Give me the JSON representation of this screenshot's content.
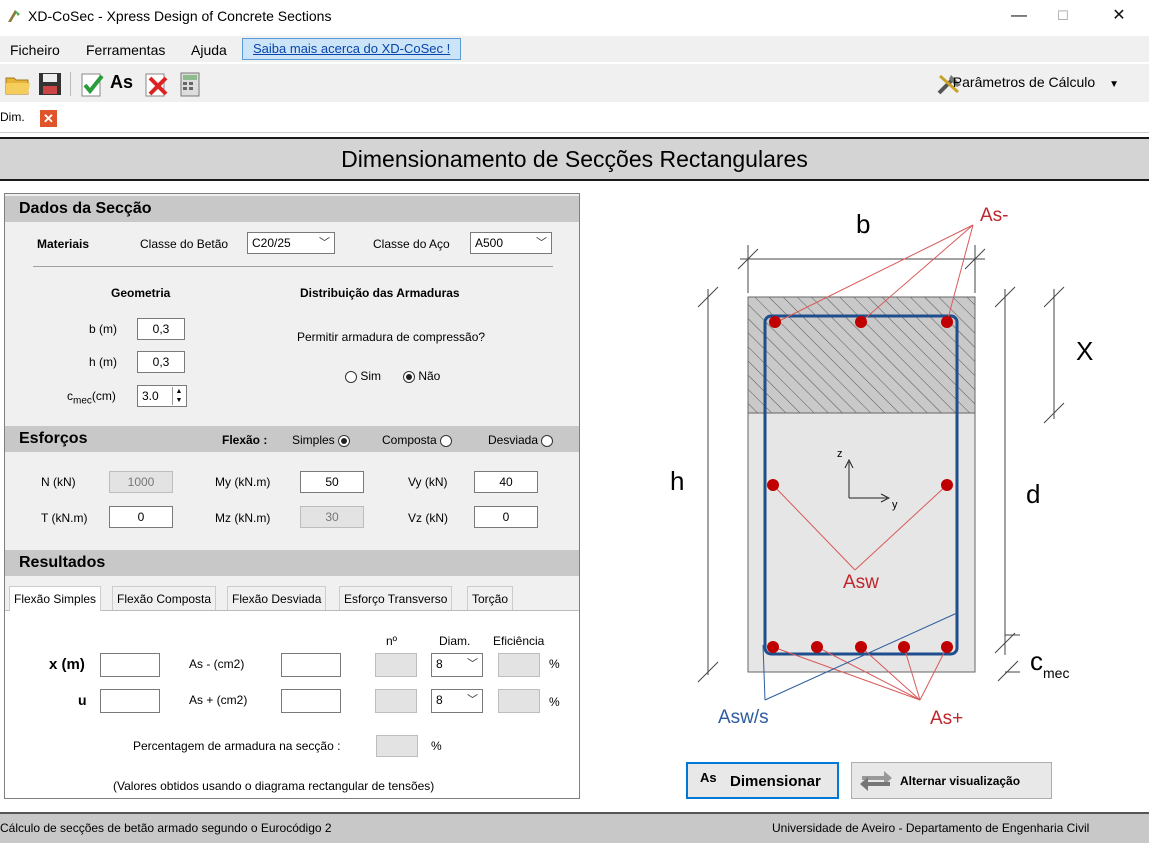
{
  "window": {
    "title": "XD-CoSec  -  Xpress Design of Concrete Sections",
    "minimize": "—",
    "maximize": "☐",
    "close": "✕"
  },
  "menu": {
    "ficheiro": "Ficheiro",
    "ferramentas": "Ferramentas",
    "ajuda": "Ajuda",
    "promo": "Saiba mais acerca do XD-CoSec !"
  },
  "toolbar": {
    "params_label": "Parâmetros de Cálculo",
    "as_label": "As"
  },
  "doc_tab": {
    "label": "Dim."
  },
  "page_title": "Dimensionamento de Secções Rectangulares",
  "dados": {
    "title": "Dados da Secção",
    "materiais": "Materiais",
    "betao_label": "Classe do Betão",
    "betao_value": "C20/25",
    "aco_label": "Classe do Aço",
    "aco_value": "A500",
    "geometria": "Geometria",
    "distribuicao": "Distribuição das Armaduras",
    "b_label": "b (m)",
    "b_value": "0,3",
    "h_label": "h (m)",
    "h_value": "0,3",
    "cmec_c": "c",
    "cmec_sub": "mec",
    "cmec_unit": "(cm)",
    "cmec_value": "3.0",
    "compressao_q": "Permitir armadura de compressão?",
    "sim": "Sim",
    "nao": "Não",
    "compressao_selected": "Não"
  },
  "esforcos": {
    "title": "Esforços",
    "flexao_label": "Flexão :",
    "simples": "Simples",
    "composta": "Composta",
    "desviada": "Desviada",
    "flexao_selected": "Simples",
    "n_label": "N (kN)",
    "n_value": "1000",
    "t_label": "T (kN.m)",
    "t_value": "0",
    "my_label": "My (kN.m)",
    "my_value": "50",
    "mz_label": "Mz (kN.m)",
    "mz_value": "30",
    "vy_label": "Vy (kN)",
    "vy_value": "40",
    "vz_label": "Vz (kN)",
    "vz_value": "0"
  },
  "resultados": {
    "title": "Resultados",
    "tabs": [
      "Flexão Simples",
      "Flexão Composta",
      "Flexão Desviada",
      "Esforço Transverso",
      "Torção"
    ],
    "active_tab": "Flexão Simples",
    "n_header": "nº",
    "diam_header": "Diam.",
    "efic_header": "Eficiência",
    "x_label": "x  (m)",
    "u_label": "u",
    "as_minus": "As - (cm2)",
    "as_plus": "As + (cm2)",
    "diam_top": "8",
    "diam_bot": "8",
    "pct": "%",
    "percentagem_label": "Percentagem  de armadura na secção :",
    "nota": "(Valores obtidos usando o diagrama rectangular de tensões)"
  },
  "diagram": {
    "b": "b",
    "h": "h",
    "d": "d",
    "x": "X",
    "c": "c",
    "c_sub": "mec",
    "as_minus": "As-",
    "as_plus": "As+",
    "asw": "Asw",
    "asw_s": "Asw/s",
    "axis_z": "z",
    "axis_y": "y"
  },
  "buttons": {
    "dimensionar": "Dimensionar",
    "dimensionar_icon": "As",
    "alternar": "Alternar visualização"
  },
  "status": {
    "left": "Cálculo de secções de betão armado segundo o Eurocódigo 2",
    "right": "Universidade de Aveiro - Departamento de Engenharia Civil"
  },
  "colors": {
    "accent": "#0078d7",
    "rebar": "#c00000",
    "stirrup": "#1f4e8c",
    "annotation_red": "#c0262d",
    "annotation_blue": "#2e5d9e"
  }
}
